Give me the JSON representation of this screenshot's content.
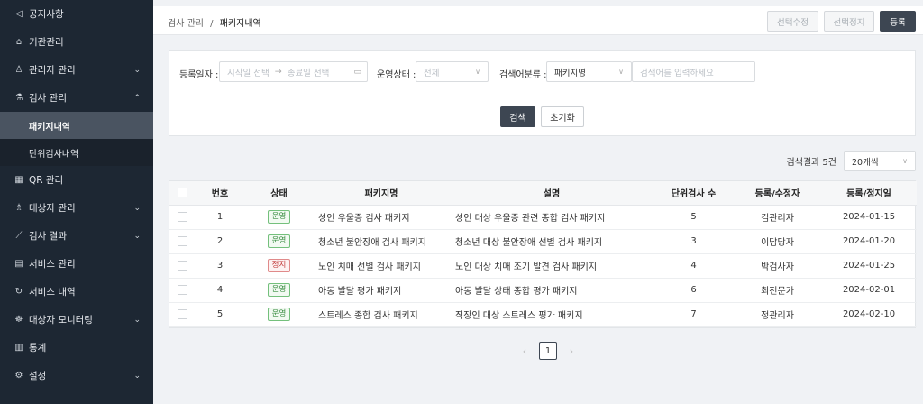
{
  "sidebar": {
    "items": [
      {
        "icon": "megaphone-icon",
        "glyph": "◁",
        "label": "공지사항",
        "chevron": ""
      },
      {
        "icon": "bank-icon",
        "glyph": "⌂",
        "label": "기관관리",
        "chevron": ""
      },
      {
        "icon": "user-icon",
        "glyph": "♙",
        "label": "관리자 관리",
        "chevron": "⌄"
      },
      {
        "icon": "flask-icon",
        "glyph": "⚗",
        "label": "검사 관리",
        "chevron": "⌃"
      }
    ],
    "sub_items": [
      {
        "label": "패키지내역",
        "active": true
      },
      {
        "label": "단위검사내역",
        "active": false
      }
    ],
    "items2": [
      {
        "icon": "qr-icon",
        "glyph": "▦",
        "label": "QR 관리",
        "chevron": ""
      },
      {
        "icon": "users-icon",
        "glyph": "♗",
        "label": "대상자 관리",
        "chevron": "⌄"
      },
      {
        "icon": "chart-line-icon",
        "glyph": "⟋",
        "label": "검사 결과",
        "chevron": "⌄"
      },
      {
        "icon": "grid-icon",
        "glyph": "▤",
        "label": "서비스 관리",
        "chevron": ""
      },
      {
        "icon": "history-icon",
        "glyph": "↻",
        "label": "서비스 내역",
        "chevron": ""
      },
      {
        "icon": "monitor-icon",
        "glyph": "☸",
        "label": "대상자 모니터링",
        "chevron": "⌄"
      },
      {
        "icon": "bar-chart-icon",
        "glyph": "▥",
        "label": "통계",
        "chevron": ""
      },
      {
        "icon": "gear-icon",
        "glyph": "⚙",
        "label": "설정",
        "chevron": "⌄"
      }
    ]
  },
  "header": {
    "breadcrumb_parent": "검사 관리",
    "breadcrumb_sep": "/",
    "breadcrumb_current": "패키지내역",
    "btn_edit": "선택수정",
    "btn_stop": "선택정지",
    "btn_register": "등록"
  },
  "search": {
    "date_label": "등록일자 :",
    "start_placeholder": "시작일 선택",
    "arrow": "→",
    "end_placeholder": "종료일 선택",
    "status_label": "운영상태 :",
    "status_value": "전체",
    "category_label": "검색어분류 :",
    "category_value": "패키지명",
    "keyword_placeholder": "검색어를 입력하세요",
    "search_btn": "검색",
    "reset_btn": "초기화"
  },
  "result": {
    "count_text": "검색결과 5건",
    "page_size": "20개씩"
  },
  "table": {
    "headers": [
      "번호",
      "상태",
      "패키지명",
      "설명",
      "단위검사 수",
      "등록/수정자",
      "등록/정지일"
    ],
    "rows": [
      {
        "no": "1",
        "status": "운영",
        "stopped": false,
        "name": "성인 우울증 검사 패키지",
        "desc": "성인 대상 우울증 관련 종합 검사 패키지",
        "count": "5",
        "user": "김관리자",
        "date": "2024-01-15"
      },
      {
        "no": "2",
        "status": "운영",
        "stopped": false,
        "name": "청소년 불안장애 검사 패키지",
        "desc": "청소년 대상 불안장애 선별 검사 패키지",
        "count": "3",
        "user": "이담당자",
        "date": "2024-01-20"
      },
      {
        "no": "3",
        "status": "정지",
        "stopped": true,
        "name": "노인 치매 선별 검사 패키지",
        "desc": "노인 대상 치매 조기 발견 검사 패키지",
        "count": "4",
        "user": "박검사자",
        "date": "2024-01-25"
      },
      {
        "no": "4",
        "status": "운영",
        "stopped": false,
        "name": "아동 발달 평가 패키지",
        "desc": "아동 발달 상태 종합 평가 패키지",
        "count": "6",
        "user": "최전문가",
        "date": "2024-02-01"
      },
      {
        "no": "5",
        "status": "운영",
        "stopped": false,
        "name": "스트레스 종합 검사 패키지",
        "desc": "직장인 대상 스트레스 평가 패키지",
        "count": "7",
        "user": "정관리자",
        "date": "2024-02-10"
      }
    ]
  },
  "pagination": {
    "prev": "‹",
    "current": "1",
    "next": "›"
  }
}
